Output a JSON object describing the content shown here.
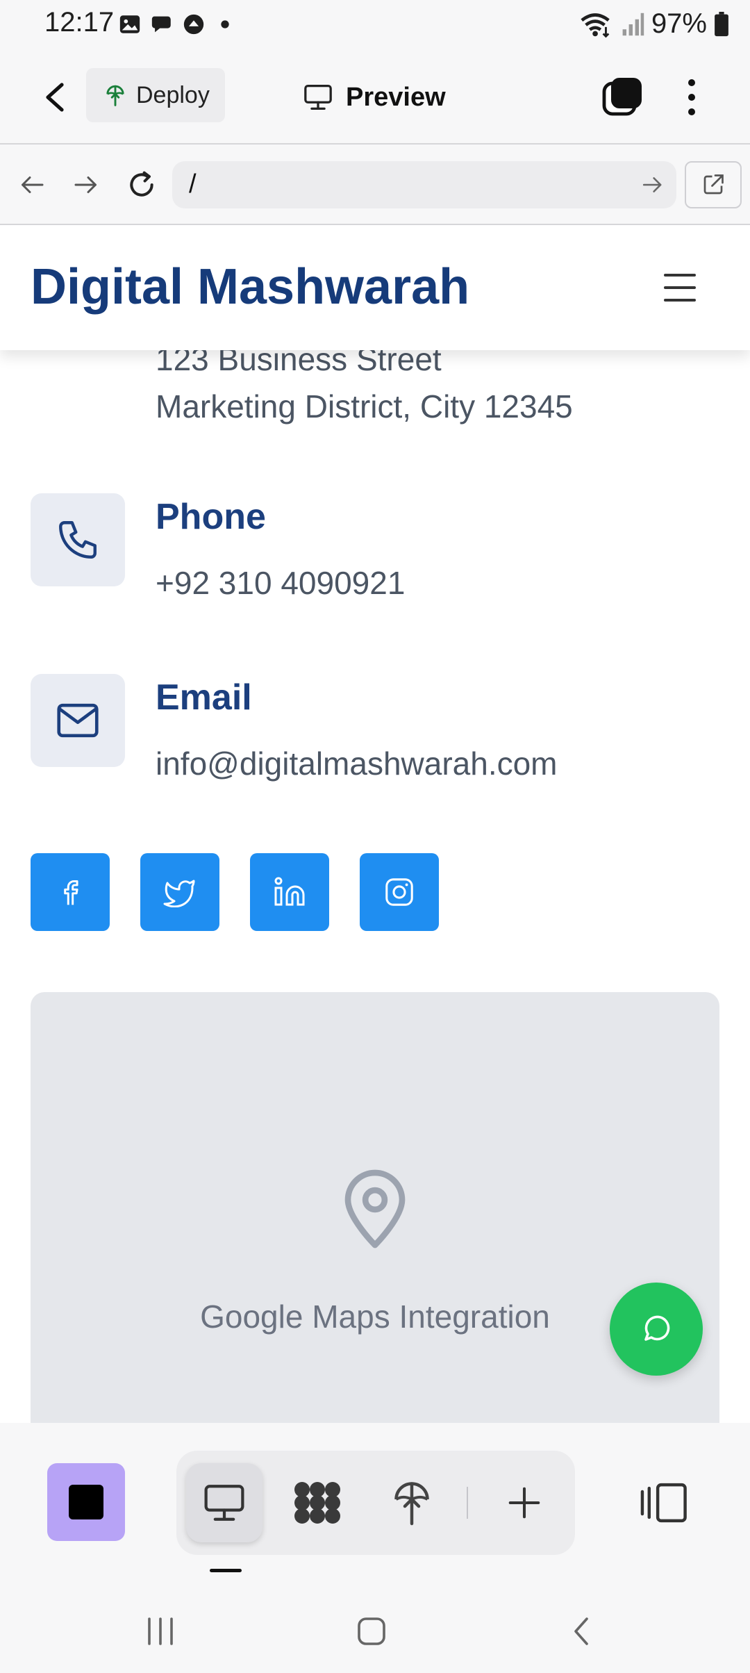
{
  "status_bar": {
    "time": "12:17",
    "battery": "97%",
    "icons": [
      "image-icon",
      "chat-bubble-icon",
      "upload-icon",
      "dot-icon",
      "wifi-icon",
      "signal-icon",
      "battery-icon"
    ]
  },
  "toolbar": {
    "deploy_label": "Deploy",
    "preview_label": "Preview",
    "icons": [
      "back-arrow-icon",
      "deploy-icon",
      "monitor-icon",
      "tabs-icon",
      "more-vertical-icon"
    ]
  },
  "url_bar": {
    "url": "/",
    "icons": [
      "back-icon",
      "forward-icon",
      "reload-icon",
      "go-arrow-icon",
      "open-external-icon"
    ]
  },
  "site": {
    "title": "Digital Mashwarah",
    "address": {
      "line1": "123 Business Street",
      "line2": "Marketing District, City 12345"
    },
    "phone": {
      "heading": "Phone",
      "value": "+92 310 4090921"
    },
    "email": {
      "heading": "Email",
      "value": "info@digitalmashwarah.com"
    },
    "social": [
      "facebook",
      "twitter",
      "linkedin",
      "instagram"
    ],
    "map_label": "Google Maps Integration"
  },
  "bottom_bar": {
    "modes": [
      "desktop",
      "components",
      "deploy",
      "add"
    ]
  },
  "colors": {
    "brand_navy": "#163b7a",
    "social_blue": "#1f8ef1",
    "fab_green": "#22c35e",
    "app_purple": "#b7a3f6"
  }
}
